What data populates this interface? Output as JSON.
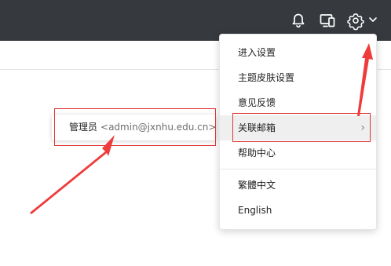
{
  "topbar": {
    "icons": [
      "bell-icon",
      "devices-icon",
      "gear-icon",
      "chevron-down-icon"
    ]
  },
  "menu": {
    "items": [
      {
        "label": "进入设置"
      },
      {
        "label": "主题皮肤设置"
      },
      {
        "label": "意见反馈"
      },
      {
        "label": "关联邮箱",
        "has_submenu": true,
        "active": true
      },
      {
        "label": "帮助中心"
      },
      {
        "label": "繁體中文"
      },
      {
        "label": "English"
      }
    ],
    "submenu_arrow": "›"
  },
  "popover": {
    "name": "管理员",
    "email": "<admin@jxnhu.edu.cn>"
  },
  "colors": {
    "topbar_bg": "#363a3f",
    "highlight_red": "#e03434",
    "active_item_bg": "#efefef"
  }
}
